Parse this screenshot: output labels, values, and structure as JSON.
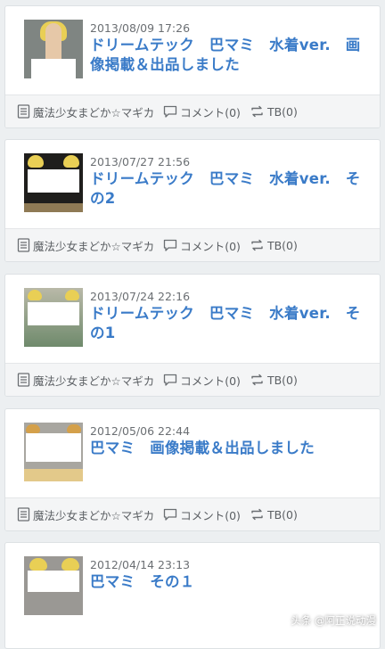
{
  "posts": [
    {
      "date": "2013/08/09 17:26",
      "title": "ドリームテック　巴マミ　水着ver.　画像掲載＆出品しました",
      "category": "魔法少女まどか☆マギカ",
      "comments": "コメント(0)",
      "trackbacks": "TB(0)"
    },
    {
      "date": "2013/07/27 21:56",
      "title": "ドリームテック　巴マミ　水着ver.　その2",
      "category": "魔法少女まどか☆マギカ",
      "comments": "コメント(0)",
      "trackbacks": "TB(0)"
    },
    {
      "date": "2013/07/24 22:16",
      "title": "ドリームテック　巴マミ　水着ver.　その1",
      "category": "魔法少女まどか☆マギカ",
      "comments": "コメント(0)",
      "trackbacks": "TB(0)"
    },
    {
      "date": "2012/05/06 22:44",
      "title": "巴マミ　画像掲載＆出品しました",
      "category": "魔法少女まどか☆マギカ",
      "comments": "コメント(0)",
      "trackbacks": "TB(0)"
    },
    {
      "date": "2012/04/14 23:13",
      "title": "巴マミ　その１"
    }
  ],
  "watermark": "头条 @阿正说动漫",
  "colors": {
    "title": "#3a7bc8",
    "meta": "#6b6f73",
    "background": "#eceff1"
  },
  "icons": {
    "category": "document-icon",
    "comments": "comment-bubble-icon",
    "trackbacks": "trackback-arrows-icon"
  }
}
